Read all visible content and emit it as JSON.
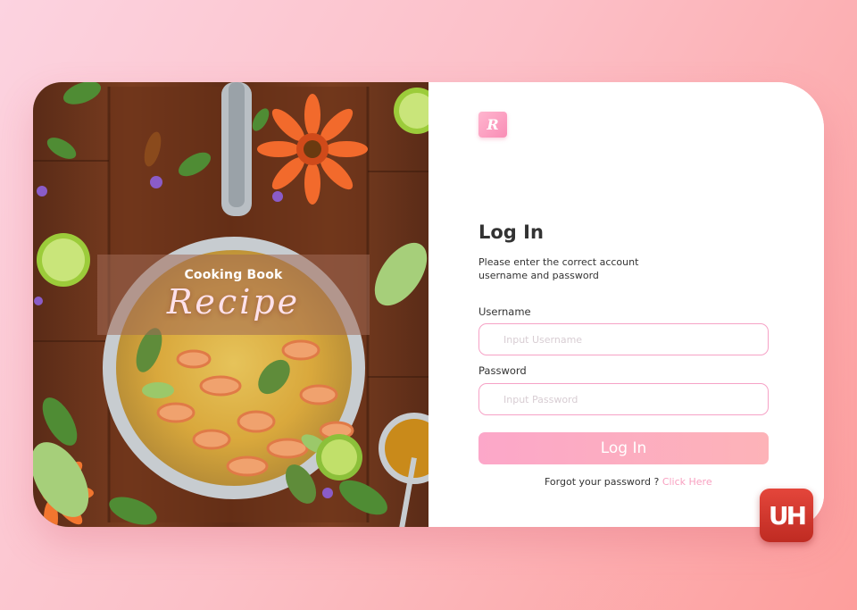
{
  "banner": {
    "subtitle": "Cooking Book",
    "title": "Recipe"
  },
  "logo": {
    "letter": "R"
  },
  "form": {
    "title": "Log In",
    "description": "Please enter the correct account username and password",
    "username_label": "Username",
    "username_placeholder": "Input Username",
    "username_value": "",
    "password_label": "Password",
    "password_placeholder": "Input Password",
    "password_value": "",
    "submit_label": "Log In",
    "forgot_text": "Forgot your password ?",
    "forgot_link": "Click Here"
  },
  "badge": {
    "text": "UH"
  },
  "colors": {
    "accent": "#f8a0c0",
    "button_gradient_start": "#fca7c9",
    "button_gradient_end": "#fdb3b8",
    "input_border": "#f6a2c6",
    "badge_red": "#d63a30"
  }
}
